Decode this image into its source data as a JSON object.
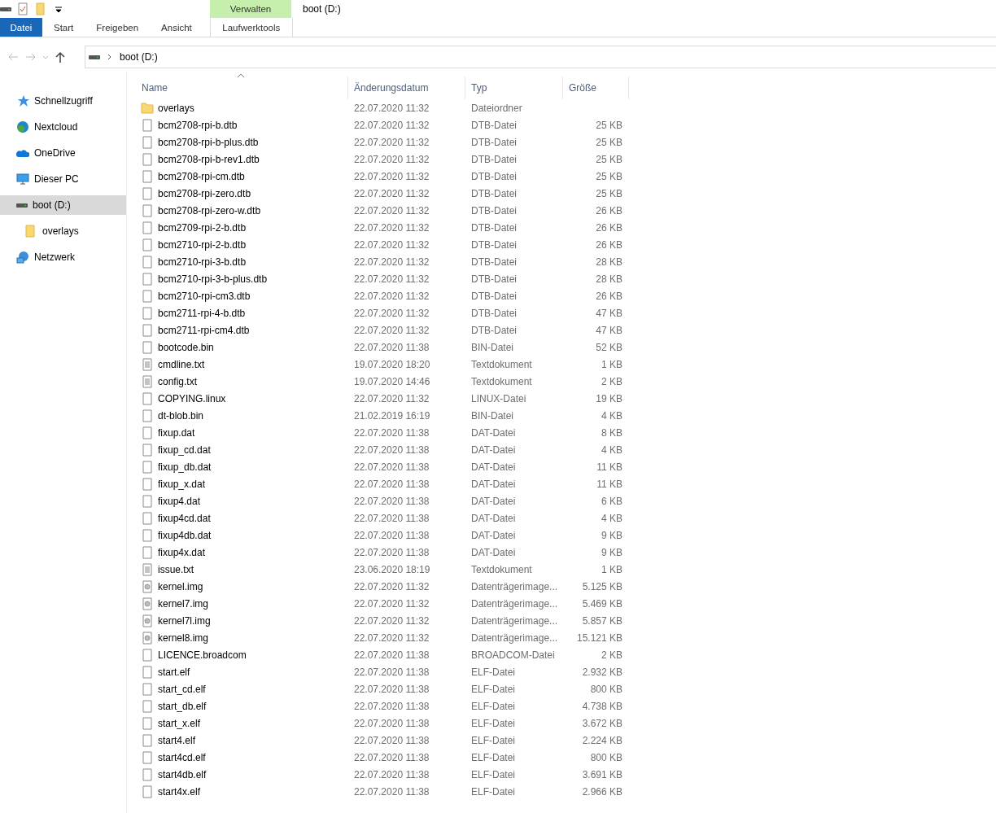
{
  "window": {
    "title": "boot (D:)"
  },
  "ribbon": {
    "context_group": "Verwalten",
    "tabs": [
      {
        "label": "Datei",
        "kind": "file",
        "selected": false
      },
      {
        "label": "Start",
        "kind": "tab",
        "selected": false
      },
      {
        "label": "Freigeben",
        "kind": "tab",
        "selected": false
      },
      {
        "label": "Ansicht",
        "kind": "tab",
        "selected": false
      },
      {
        "label": "Laufwerktools",
        "kind": "context",
        "selected": false
      }
    ]
  },
  "address": {
    "path": "boot (D:)"
  },
  "sidebar": {
    "items": [
      {
        "label": "Schnellzugriff",
        "kind": "star",
        "selected": false
      },
      {
        "label": "Nextcloud",
        "kind": "cloud-app",
        "selected": false
      },
      {
        "label": "OneDrive",
        "kind": "cloud",
        "selected": false
      },
      {
        "label": "Dieser PC",
        "kind": "pc",
        "selected": false
      },
      {
        "label": "boot (D:)",
        "kind": "drive",
        "selected": true,
        "children": [
          {
            "label": "overlays",
            "kind": "folder",
            "selected": false
          }
        ]
      },
      {
        "label": "Netzwerk",
        "kind": "network",
        "selected": false
      }
    ]
  },
  "table": {
    "columns": [
      "Name",
      "Änderungsdatum",
      "Typ",
      "Größe"
    ],
    "rows": [
      {
        "name": "overlays",
        "date": "22.07.2020 11:32",
        "type": "Dateiordner",
        "kind": "folder"
      },
      {
        "name": "bcm2708-rpi-b.dtb",
        "date": "22.07.2020 11:32",
        "type": "DTB-Datei",
        "size": "25 KB",
        "kind": "file"
      },
      {
        "name": "bcm2708-rpi-b-plus.dtb",
        "date": "22.07.2020 11:32",
        "type": "DTB-Datei",
        "size": "25 KB",
        "kind": "file"
      },
      {
        "name": "bcm2708-rpi-b-rev1.dtb",
        "date": "22.07.2020 11:32",
        "type": "DTB-Datei",
        "size": "25 KB",
        "kind": "file"
      },
      {
        "name": "bcm2708-rpi-cm.dtb",
        "date": "22.07.2020 11:32",
        "type": "DTB-Datei",
        "size": "25 KB",
        "kind": "file"
      },
      {
        "name": "bcm2708-rpi-zero.dtb",
        "date": "22.07.2020 11:32",
        "type": "DTB-Datei",
        "size": "25 KB",
        "kind": "file"
      },
      {
        "name": "bcm2708-rpi-zero-w.dtb",
        "date": "22.07.2020 11:32",
        "type": "DTB-Datei",
        "size": "26 KB",
        "kind": "file"
      },
      {
        "name": "bcm2709-rpi-2-b.dtb",
        "date": "22.07.2020 11:32",
        "type": "DTB-Datei",
        "size": "26 KB",
        "kind": "file"
      },
      {
        "name": "bcm2710-rpi-2-b.dtb",
        "date": "22.07.2020 11:32",
        "type": "DTB-Datei",
        "size": "26 KB",
        "kind": "file"
      },
      {
        "name": "bcm2710-rpi-3-b.dtb",
        "date": "22.07.2020 11:32",
        "type": "DTB-Datei",
        "size": "28 KB",
        "kind": "file"
      },
      {
        "name": "bcm2710-rpi-3-b-plus.dtb",
        "date": "22.07.2020 11:32",
        "type": "DTB-Datei",
        "size": "28 KB",
        "kind": "file"
      },
      {
        "name": "bcm2710-rpi-cm3.dtb",
        "date": "22.07.2020 11:32",
        "type": "DTB-Datei",
        "size": "26 KB",
        "kind": "file"
      },
      {
        "name": "bcm2711-rpi-4-b.dtb",
        "date": "22.07.2020 11:32",
        "type": "DTB-Datei",
        "size": "47 KB",
        "kind": "file"
      },
      {
        "name": "bcm2711-rpi-cm4.dtb",
        "date": "22.07.2020 11:32",
        "type": "DTB-Datei",
        "size": "47 KB",
        "kind": "file"
      },
      {
        "name": "bootcode.bin",
        "date": "22.07.2020 11:38",
        "type": "BIN-Datei",
        "size": "52 KB",
        "kind": "file"
      },
      {
        "name": "cmdline.txt",
        "date": "19.07.2020 18:20",
        "type": "Textdokument",
        "size": "1 KB",
        "kind": "text"
      },
      {
        "name": "config.txt",
        "date": "19.07.2020 14:46",
        "type": "Textdokument",
        "size": "2 KB",
        "kind": "text"
      },
      {
        "name": "COPYING.linux",
        "date": "22.07.2020 11:32",
        "type": "LINUX-Datei",
        "size": "19 KB",
        "kind": "file"
      },
      {
        "name": "dt-blob.bin",
        "date": "21.02.2019 16:19",
        "type": "BIN-Datei",
        "size": "4 KB",
        "kind": "file"
      },
      {
        "name": "fixup.dat",
        "date": "22.07.2020 11:38",
        "type": "DAT-Datei",
        "size": "8 KB",
        "kind": "file"
      },
      {
        "name": "fixup_cd.dat",
        "date": "22.07.2020 11:38",
        "type": "DAT-Datei",
        "size": "4 KB",
        "kind": "file"
      },
      {
        "name": "fixup_db.dat",
        "date": "22.07.2020 11:38",
        "type": "DAT-Datei",
        "size": "11 KB",
        "kind": "file"
      },
      {
        "name": "fixup_x.dat",
        "date": "22.07.2020 11:38",
        "type": "DAT-Datei",
        "size": "11 KB",
        "kind": "file"
      },
      {
        "name": "fixup4.dat",
        "date": "22.07.2020 11:38",
        "type": "DAT-Datei",
        "size": "6 KB",
        "kind": "file"
      },
      {
        "name": "fixup4cd.dat",
        "date": "22.07.2020 11:38",
        "type": "DAT-Datei",
        "size": "4 KB",
        "kind": "file"
      },
      {
        "name": "fixup4db.dat",
        "date": "22.07.2020 11:38",
        "type": "DAT-Datei",
        "size": "9 KB",
        "kind": "file"
      },
      {
        "name": "fixup4x.dat",
        "date": "22.07.2020 11:38",
        "type": "DAT-Datei",
        "size": "9 KB",
        "kind": "file"
      },
      {
        "name": "issue.txt",
        "date": "23.06.2020 18:19",
        "type": "Textdokument",
        "size": "1 KB",
        "kind": "text"
      },
      {
        "name": "kernel.img",
        "date": "22.07.2020 11:32",
        "type": "Datenträgerimage...",
        "size": "5.125 KB",
        "kind": "image"
      },
      {
        "name": "kernel7.img",
        "date": "22.07.2020 11:32",
        "type": "Datenträgerimage...",
        "size": "5.469 KB",
        "kind": "image"
      },
      {
        "name": "kernel7l.img",
        "date": "22.07.2020 11:32",
        "type": "Datenträgerimage...",
        "size": "5.857 KB",
        "kind": "image"
      },
      {
        "name": "kernel8.img",
        "date": "22.07.2020 11:32",
        "type": "Datenträgerimage...",
        "size": "15.121 KB",
        "kind": "image"
      },
      {
        "name": "LICENCE.broadcom",
        "date": "22.07.2020 11:38",
        "type": "BROADCOM-Datei",
        "size": "2 KB",
        "kind": "file"
      },
      {
        "name": "start.elf",
        "date": "22.07.2020 11:38",
        "type": "ELF-Datei",
        "size": "2.932 KB",
        "kind": "file"
      },
      {
        "name": "start_cd.elf",
        "date": "22.07.2020 11:38",
        "type": "ELF-Datei",
        "size": "800 KB",
        "kind": "file"
      },
      {
        "name": "start_db.elf",
        "date": "22.07.2020 11:38",
        "type": "ELF-Datei",
        "size": "4.738 KB",
        "kind": "file"
      },
      {
        "name": "start_x.elf",
        "date": "22.07.2020 11:38",
        "type": "ELF-Datei",
        "size": "3.672 KB",
        "kind": "file"
      },
      {
        "name": "start4.elf",
        "date": "22.07.2020 11:38",
        "type": "ELF-Datei",
        "size": "2.224 KB",
        "kind": "file"
      },
      {
        "name": "start4cd.elf",
        "date": "22.07.2020 11:38",
        "type": "ELF-Datei",
        "size": "800 KB",
        "kind": "file"
      },
      {
        "name": "start4db.elf",
        "date": "22.07.2020 11:38",
        "type": "ELF-Datei",
        "size": "3.691 KB",
        "kind": "file"
      },
      {
        "name": "start4x.elf",
        "date": "22.07.2020 11:38",
        "type": "ELF-Datei",
        "size": "2.966 KB",
        "kind": "file"
      }
    ]
  }
}
